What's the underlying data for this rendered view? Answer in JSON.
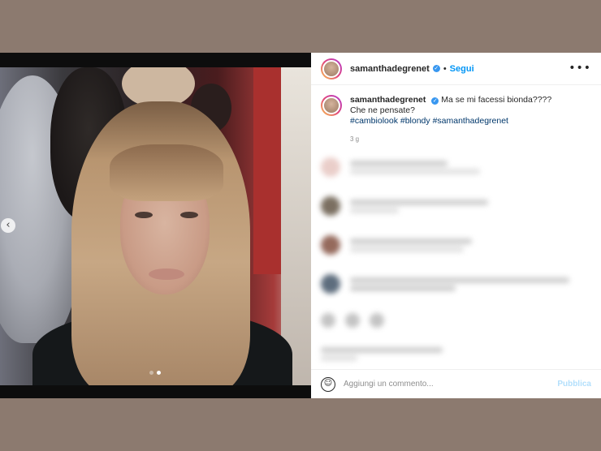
{
  "post": {
    "carousel": {
      "slide_count": 2,
      "active_slide": 2
    },
    "nav_prev_icon": "‹"
  },
  "header": {
    "username": "samanthadegrenet",
    "verified_icon": "✓",
    "separator": "•",
    "follow_label": "Segui",
    "more_icon": "•••"
  },
  "caption": {
    "username": "samanthadegrenet",
    "verified_icon": "✓",
    "line1": "Ma se mi facessi bionda????",
    "line2": "Che ne pensate?",
    "hashtags": "#cambiolook #blondy #samanthadegrenet",
    "time": "3 g"
  },
  "composer": {
    "emoji_icon": "☺",
    "placeholder": "Aggiungi un commento...",
    "publish_label": "Pubblica"
  },
  "colors": {
    "backdrop": "#8c7a6f",
    "link_blue": "#0095f6",
    "hashtag_blue": "#00376b"
  }
}
